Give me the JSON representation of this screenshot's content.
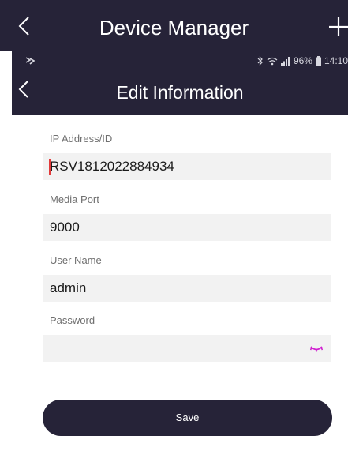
{
  "outer_header": {
    "title": "Device Manager"
  },
  "status_bar": {
    "battery": "96%",
    "time": "14:10"
  },
  "inner_header": {
    "title": "Edit Information"
  },
  "form": {
    "ip_label": "IP Address/ID",
    "ip_value": "RSV1812022884934",
    "port_label": "Media Port",
    "port_value": "9000",
    "user_label": "User Name",
    "user_value": "admin",
    "password_label": "Password",
    "password_value": ""
  },
  "save_label": "Save",
  "colors": {
    "header_bg": "#262338",
    "field_bg": "#f2f2f2",
    "eye_icon": "#d020d0"
  }
}
